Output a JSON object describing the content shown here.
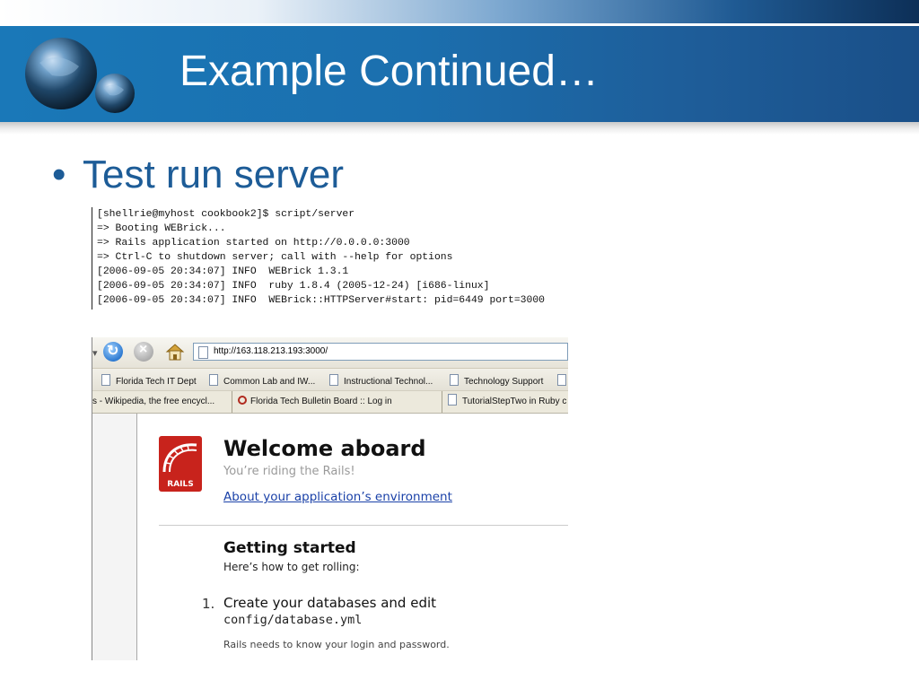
{
  "slide": {
    "title": "Example Continued…",
    "bullet": "Test run server"
  },
  "terminal": {
    "lines": [
      "[shellrie@myhost cookbook2]$ script/server",
      "=> Booting WEBrick...",
      "=> Rails application started on http://0.0.0.0:3000",
      "=> Ctrl-C to shutdown server; call with --help for options",
      "[2006-09-05 20:34:07] INFO  WEBrick 1.3.1",
      "[2006-09-05 20:34:07] INFO  ruby 1.8.4 (2005-12-24) [i686-linux]",
      "[2006-09-05 20:34:07] INFO  WEBrick::HTTPServer#start: pid=6449 port=3000"
    ]
  },
  "browser": {
    "url": "http://163.118.213.193:3000/",
    "bookmarks": [
      "Florida Tech IT Dept",
      "Common Lab and IW...",
      "Instructional Technol...",
      "Technology Support"
    ],
    "tabs": [
      "s - Wikipedia, the free encycl...",
      "Florida Tech Bulletin Board :: Log in",
      "TutorialStepTwo in Ruby c"
    ],
    "page": {
      "logo_text": "RAILS",
      "welcome_title": "Welcome aboard",
      "welcome_subtitle": "You’re riding the Rails!",
      "env_link": "About your application’s environment",
      "getting_started_title": "Getting started",
      "getting_started_subtitle": "Here’s how to get rolling:",
      "step_number": "1.",
      "step_title": "Create your databases and edit",
      "step_code": "config/database.yml",
      "step_desc": "Rails needs to know your login and password."
    }
  },
  "colors": {
    "header_blue": "#1b6fae",
    "title_text": "#ffffff",
    "bullet_text": "#1d5c97",
    "link_blue": "#1a41a8",
    "rails_red": "#c8231c"
  }
}
